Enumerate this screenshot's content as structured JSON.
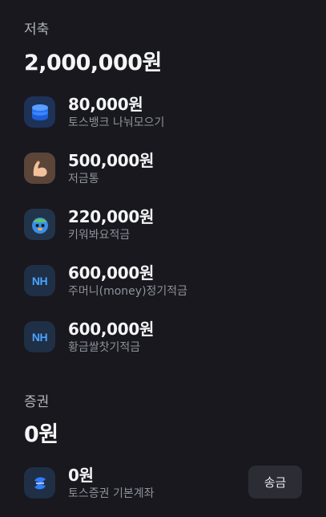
{
  "savings": {
    "label": "저축",
    "total": "2,000,000원",
    "accounts": [
      {
        "amount": "80,000원",
        "name": "토스뱅크 나눠모으기",
        "icon": "coin-stack-icon"
      },
      {
        "amount": "500,000원",
        "name": "저금통",
        "icon": "flexed-arm-icon"
      },
      {
        "amount": "220,000원",
        "name": "키워봐요적금",
        "icon": "character-icon"
      },
      {
        "amount": "600,000원",
        "name": "주머니(money)정기적금",
        "icon": "nh-bank-icon",
        "icon_text": "NH"
      },
      {
        "amount": "600,000원",
        "name": "황금쌀찻기적금",
        "icon": "nh-bank-icon",
        "icon_text": "NH"
      }
    ]
  },
  "securities": {
    "label": "증권",
    "total": "0원",
    "accounts": [
      {
        "amount": "0원",
        "name": "토스증권 기본계좌",
        "icon": "toss-securities-icon",
        "action": "송금"
      }
    ]
  },
  "colors": {
    "background": "#18181e",
    "nh_blue": "#4aa3ff",
    "toss_blue": "#2e7dff"
  }
}
